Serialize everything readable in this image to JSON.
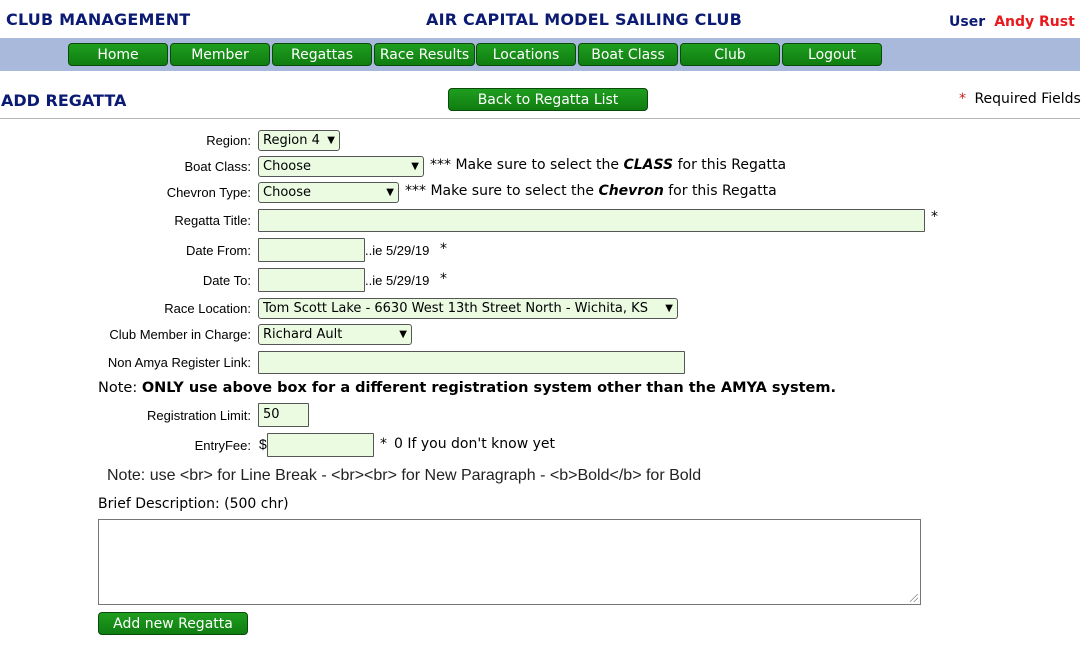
{
  "header": {
    "left_title": "CLUB MANAGEMENT",
    "center_title": "AIR CAPITAL MODEL SAILING CLUB",
    "user_label": "User",
    "user_name": "Andy Rust"
  },
  "nav": [
    {
      "label": "Home"
    },
    {
      "label": "Member"
    },
    {
      "label": "Regattas"
    },
    {
      "label": "Race Results"
    },
    {
      "label": "Locations"
    },
    {
      "label": "Boat Class"
    },
    {
      "label": "Club"
    },
    {
      "label": "Logout"
    }
  ],
  "page": {
    "title": "ADD REGATTA",
    "back_button": "Back to Regatta List",
    "required_star": "*",
    "required_label": "Required Fields"
  },
  "form": {
    "region": {
      "label": "Region:",
      "value": "Region 4"
    },
    "boat_class": {
      "label": "Boat Class:",
      "value": "Choose",
      "note_prefix": "*** Make sure to select the ",
      "note_em": "CLASS",
      "note_suffix": " for this Regatta"
    },
    "chevron": {
      "label": "Chevron Type:",
      "value": "Choose",
      "note_prefix": "*** Make sure to select the ",
      "note_em": "Chevron",
      "note_suffix": " for this Regatta"
    },
    "title": {
      "label": "Regatta Title:",
      "value": "",
      "star": "*"
    },
    "date_from": {
      "label": "Date From:",
      "value": "",
      "hint": "..ie 5/29/19",
      "star": "*"
    },
    "date_to": {
      "label": "Date To:",
      "value": "",
      "hint": "..ie 5/29/19",
      "star": "*"
    },
    "location": {
      "label": "Race Location:",
      "value": "Tom Scott Lake - 6630 West 13th Street North - Wichita, KS"
    },
    "member": {
      "label": "Club Member in Charge:",
      "value": "Richard Ault"
    },
    "register_link": {
      "label": "Non Amya Register Link:",
      "value": ""
    },
    "note_prefix": "Note: ",
    "note_bold": "ONLY use above box for a different registration system other than the AMYA system.",
    "reg_limit": {
      "label": "Registration Limit:",
      "value": "50"
    },
    "entry_fee": {
      "label": "EntryFee:",
      "currency": "$",
      "value": "",
      "star": "*",
      "hint": "0 If you don't know yet"
    },
    "format_note": "Note: use <br> for Line Break - <br><br> for New Paragraph - <b>Bold</b> for Bold",
    "description_label": "Brief Description: (500 chr)",
    "description_value": "",
    "submit": "Add new Regatta"
  },
  "colors": {
    "brand_blue": "#0b1a72",
    "nav_bar": "#a9b9db",
    "button_green": "#1a911a",
    "required_red": "#c21919",
    "input_bg": "#eafbe2"
  }
}
